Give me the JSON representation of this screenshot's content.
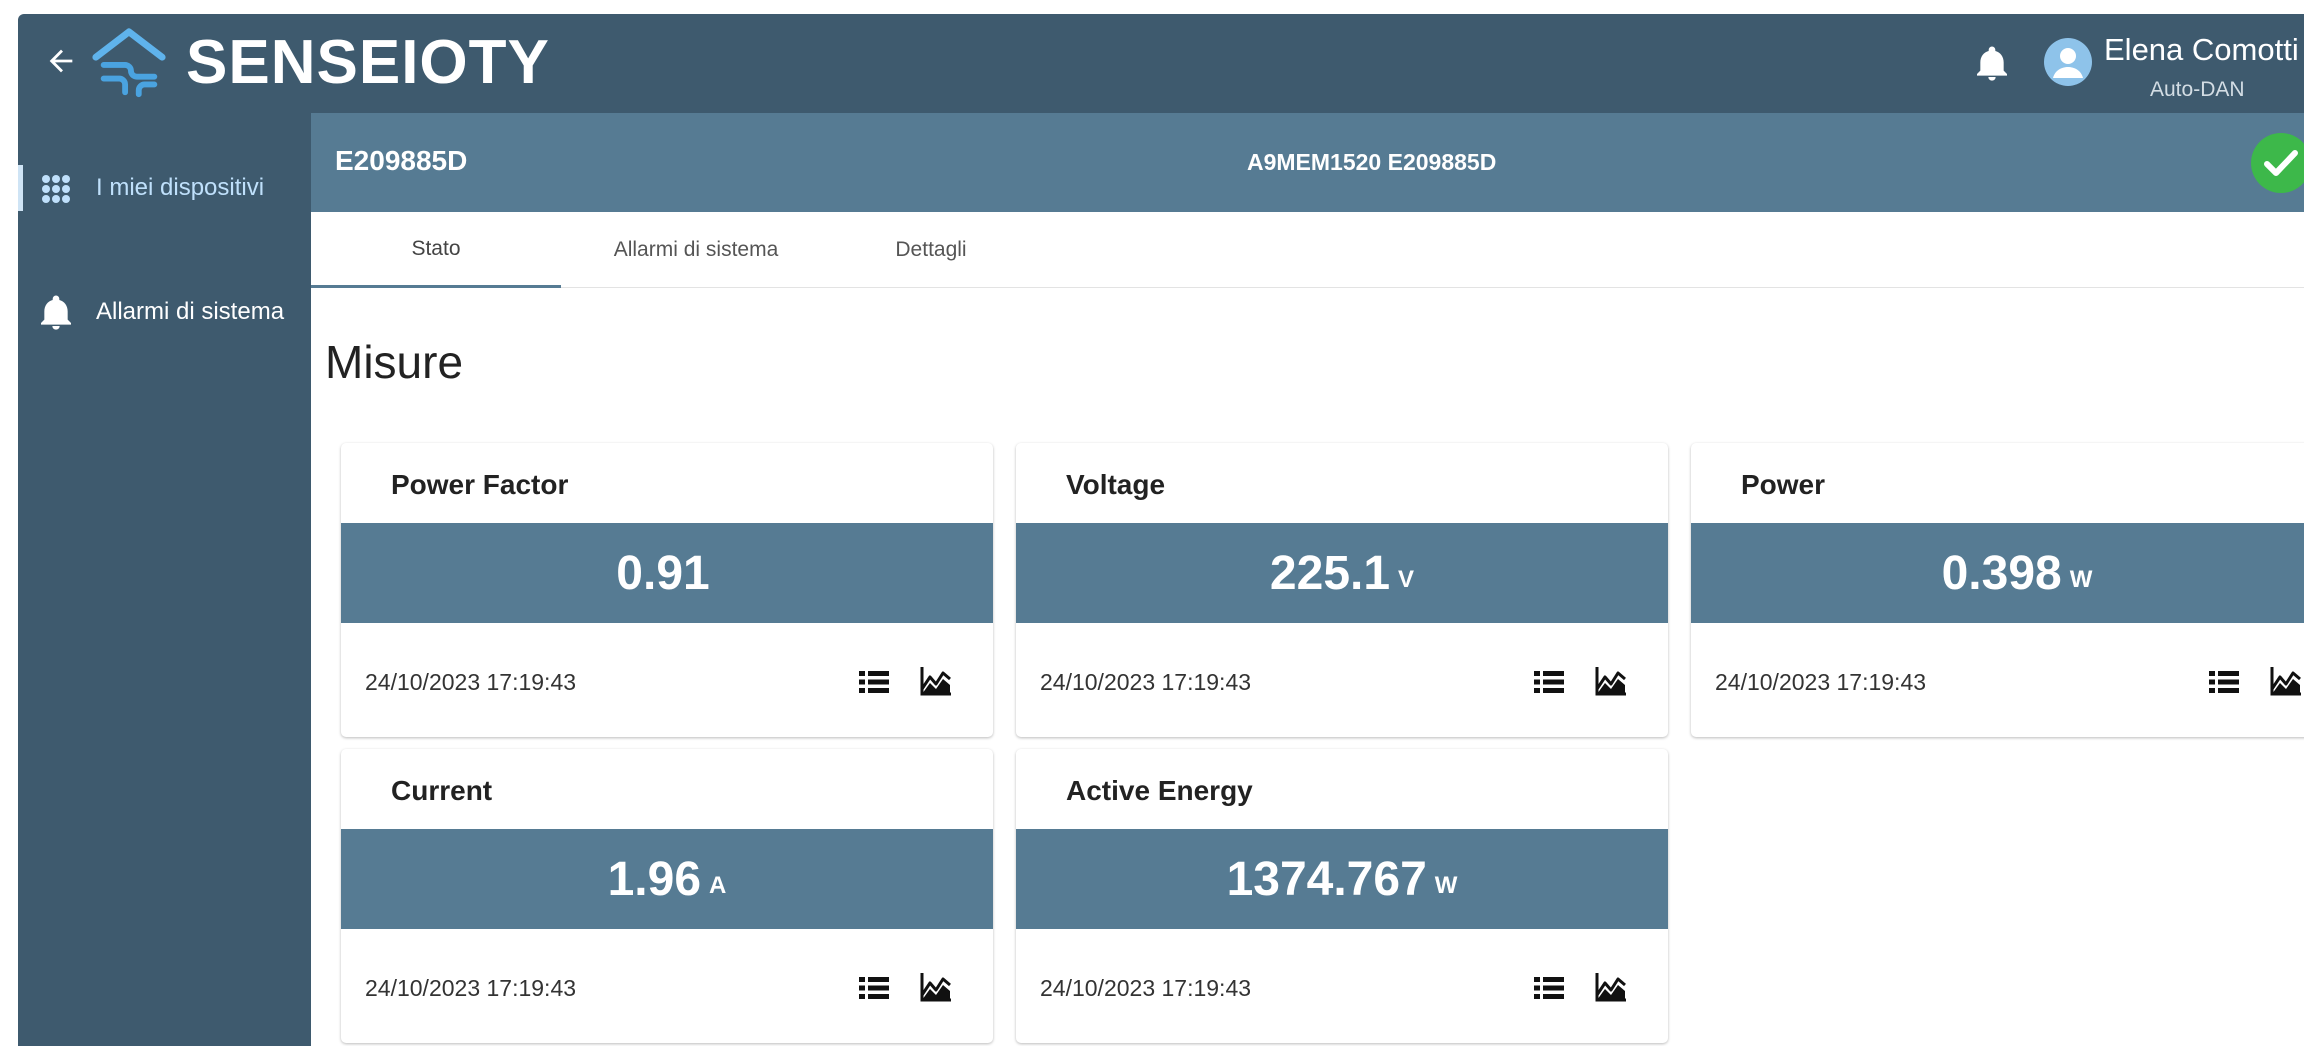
{
  "app": {
    "brand": "SENSEIOTY",
    "user_name": "Elena Comotti",
    "user_org": "Auto-DAN"
  },
  "sidebar": {
    "items": [
      {
        "label": "I miei dispositivi",
        "icon": "grid-icon",
        "active": true
      },
      {
        "label": "Allarmi di sistema",
        "icon": "bell-icon",
        "active": false
      }
    ]
  },
  "device": {
    "id": "E209885D",
    "model": "A9MEM1520 E209885D",
    "status_icon": "check-icon",
    "status_color": "#3db84a"
  },
  "tabs": [
    {
      "label": "Stato",
      "active": true
    },
    {
      "label": "Allarmi di sistema",
      "active": false
    },
    {
      "label": "Dettagli",
      "active": false
    }
  ],
  "section": {
    "title": "Misure"
  },
  "measures": [
    {
      "title": "Power Factor",
      "value": "0.91",
      "unit": "",
      "timestamp": "24/10/2023 17:19:43"
    },
    {
      "title": "Voltage",
      "value": "225.1",
      "unit": "V",
      "timestamp": "24/10/2023 17:19:43"
    },
    {
      "title": "Power",
      "value": "0.398",
      "unit": "W",
      "timestamp": "24/10/2023 17:19:43"
    },
    {
      "title": "Current",
      "value": "1.96",
      "unit": "A",
      "timestamp": "24/10/2023 17:19:43"
    },
    {
      "title": "Active Energy",
      "value": "1374.767",
      "unit": "W",
      "timestamp": "24/10/2023 17:19:43"
    }
  ],
  "colors": {
    "topbar": "#3e5a6e",
    "accent": "#567b93",
    "active_nav": "#bfe0fb"
  }
}
